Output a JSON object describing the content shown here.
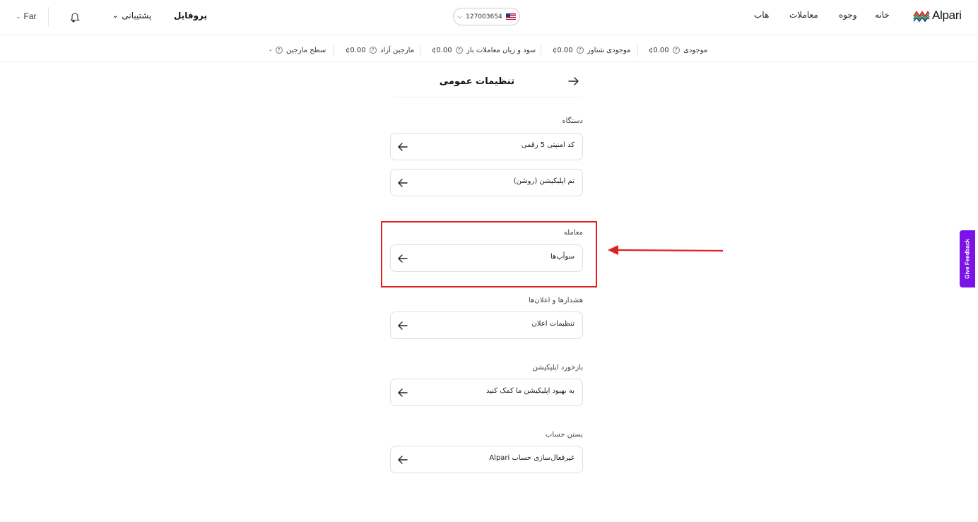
{
  "header": {
    "brand": "Alpari",
    "nav": {
      "home": "خانه",
      "funds": "وجوه",
      "trades": "معاملات",
      "hub": "هاب"
    },
    "account_number": "127003654",
    "profile": "پروفایل",
    "support": "پشتیبانی",
    "language": "Far"
  },
  "stats": {
    "balance_label": "موجودی",
    "balance_value": "¢0.00",
    "floating_label": "موجودی شناور",
    "floating_value": "¢0.00",
    "pnl_label": "سود و زیان معاملات باز",
    "pnl_value": "¢0.00",
    "free_margin_label": "مارجین آزاد",
    "free_margin_value": "¢0.00",
    "margin_level_label": "سطح مارجین",
    "margin_level_value": "-"
  },
  "page": {
    "title": "تنظیمات عمومی"
  },
  "sections": {
    "device": {
      "label": "دستگاه",
      "items": [
        "کد امنیتی 5 رقمی",
        "تم اپلیکیشن (روشن)"
      ]
    },
    "trading": {
      "label": "معامله",
      "items": [
        "سوآپ‌ها"
      ]
    },
    "alerts": {
      "label": "هشدارها و اعلان‌ها",
      "items": [
        "تنظیمات اعلان"
      ]
    },
    "feedback": {
      "label": "بازخورد اپلیکیشن",
      "items": [
        "به بهبود اپلیکیشن ما کمک کنید"
      ]
    },
    "close": {
      "label": "بستن حساب",
      "items": [
        "غیرفعال‌سازی حساب Alpari"
      ]
    }
  },
  "feedback_tab": "Give Feedback",
  "colors": {
    "accent": "#7b12e6",
    "annotation": "#e02020"
  }
}
